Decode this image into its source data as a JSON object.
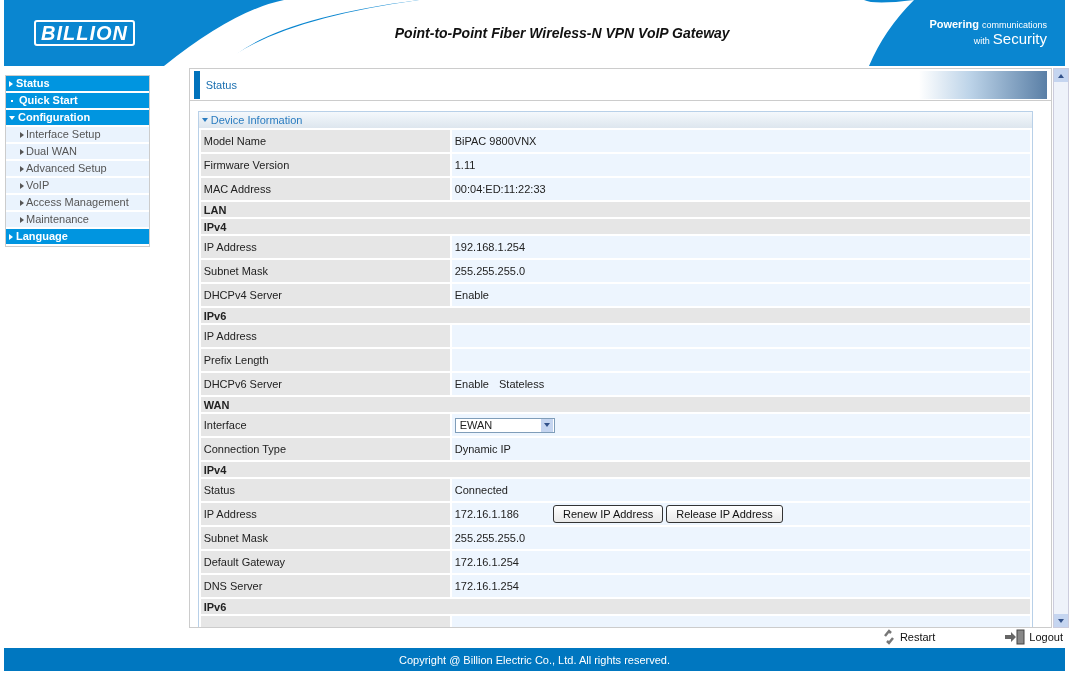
{
  "header": {
    "logo": "BILLION",
    "title": "Point-to-Point Fiber Wireless-N VPN VoIP Gateway",
    "tagline": [
      "Powering",
      "communications",
      "with",
      "Security"
    ]
  },
  "sidebar": {
    "items": [
      {
        "label": "Status",
        "kind": "folder",
        "expanded": false
      },
      {
        "label": "Quick Start",
        "kind": "link"
      },
      {
        "label": "Configuration",
        "kind": "folder",
        "expanded": true,
        "children": [
          {
            "label": "Interface Setup"
          },
          {
            "label": "Dual WAN"
          },
          {
            "label": "Advanced Setup"
          },
          {
            "label": "VoIP"
          },
          {
            "label": "Access Management"
          },
          {
            "label": "Maintenance"
          }
        ]
      },
      {
        "label": "Language",
        "kind": "folder",
        "expanded": false
      }
    ]
  },
  "page": {
    "title": "Status",
    "section": {
      "title": "Device Information",
      "expanded": true
    },
    "rows": [
      {
        "kind": "field",
        "label": "Model Name",
        "value": "BiPAC 9800VNX"
      },
      {
        "kind": "field",
        "label": "Firmware Version",
        "value": "1.11"
      },
      {
        "kind": "field",
        "label": "MAC Address",
        "value": "00:04:ED:11:22:33"
      },
      {
        "kind": "heading",
        "label": "LAN"
      },
      {
        "kind": "heading",
        "label": "IPv4"
      },
      {
        "kind": "field",
        "label": "IP Address",
        "value": "192.168.1.254"
      },
      {
        "kind": "field",
        "label": "Subnet Mask",
        "value": "255.255.255.0"
      },
      {
        "kind": "field",
        "label": "DHCPv4 Server",
        "value": "Enable"
      },
      {
        "kind": "heading",
        "label": "IPv6"
      },
      {
        "kind": "field",
        "label": "IP Address"
      },
      {
        "kind": "field",
        "label": "Prefix Length"
      },
      {
        "kind": "field",
        "label": "DHCPv6 Server",
        "values": [
          "Enable",
          "Stateless"
        ]
      },
      {
        "kind": "heading",
        "label": "WAN"
      },
      {
        "kind": "select",
        "label": "Interface",
        "value": "EWAN"
      },
      {
        "kind": "field",
        "label": "Connection Type",
        "value": "Dynamic IP"
      },
      {
        "kind": "heading",
        "label": "IPv4"
      },
      {
        "kind": "field",
        "label": "Status",
        "value": "Connected"
      },
      {
        "kind": "buttons",
        "label": "IP Address",
        "value": "172.16.1.186",
        "buttons": [
          "Renew IP Address",
          "Release IP Address"
        ]
      },
      {
        "kind": "field",
        "label": "Subnet Mask",
        "value": "255.255.255.0"
      },
      {
        "kind": "field",
        "label": "Default Gateway",
        "value": "172.16.1.254"
      },
      {
        "kind": "field",
        "label": "DNS Server",
        "value": "172.16.1.254"
      },
      {
        "kind": "heading",
        "label": "IPv6"
      }
    ]
  },
  "actions": [
    {
      "kind": "restart",
      "label": "Restart"
    },
    {
      "kind": "logout",
      "label": "Logout"
    }
  ],
  "footer": "Copyright @ Billion Electric Co., Ltd. All rights reserved."
}
